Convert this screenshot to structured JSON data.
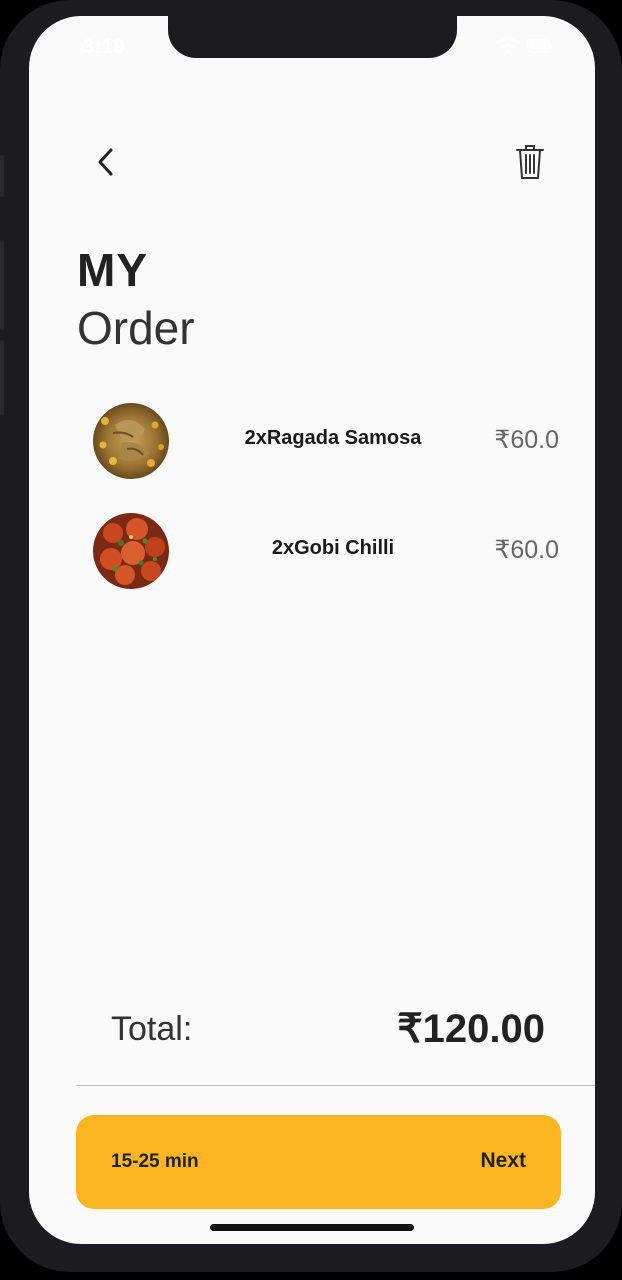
{
  "status_bar": {
    "time": "3:19"
  },
  "header": {
    "back_icon": "chevron-left-icon",
    "delete_icon": "trash-icon"
  },
  "title": {
    "strong": "MY",
    "light": "Order"
  },
  "order_items": [
    {
      "name": "2xRagada Samosa",
      "price": "₹60.0",
      "image": "ragada-samosa-photo"
    },
    {
      "name": "2xGobi Chilli",
      "price": "₹60.0",
      "image": "gobi-chilli-photo"
    }
  ],
  "total": {
    "label": "Total:",
    "value": "₹120.00"
  },
  "checkout": {
    "eta": "15-25 min",
    "next_label": "Next",
    "accent_color": "#fdb523"
  }
}
